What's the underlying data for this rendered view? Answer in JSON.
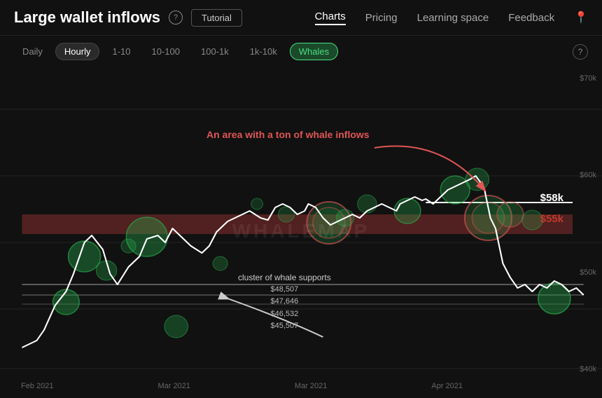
{
  "header": {
    "title": "Large wallet inflows",
    "help_label": "?",
    "tutorial_label": "Tutorial",
    "nav": [
      {
        "label": "Charts",
        "active": true
      },
      {
        "label": "Pricing",
        "active": false
      },
      {
        "label": "Learning space",
        "active": false
      },
      {
        "label": "Feedback",
        "active": false
      }
    ],
    "location_icon": "📍"
  },
  "filter_bar": {
    "filters": [
      {
        "label": "Daily",
        "active": false,
        "highlight": false
      },
      {
        "label": "Hourly",
        "active": true,
        "highlight": false
      },
      {
        "label": "1-10",
        "active": false,
        "highlight": false
      },
      {
        "label": "10-100",
        "active": false,
        "highlight": false
      },
      {
        "label": "100-1k",
        "active": false,
        "highlight": false
      },
      {
        "label": "1k-10k",
        "active": false,
        "highlight": false
      },
      {
        "label": "Whales",
        "active": false,
        "highlight": true
      }
    ],
    "info_icon": "?"
  },
  "chart": {
    "y_labels": [
      "$70k",
      "$60k",
      "$50k",
      "$40k"
    ],
    "x_labels": [
      "Feb 2021",
      "Mar 2021",
      "Mar 2021",
      "Apr 2021",
      ""
    ],
    "watermark": "WHALEMAP",
    "annotations": {
      "whale_inflow_text": "An area with a ton of whale inflows",
      "price_58k": "$58k",
      "price_55k": "$55k",
      "cluster_title": "cluster of whale supports",
      "cluster_prices": [
        "$48,507",
        "$47,646",
        "$46,532",
        "$45,507"
      ]
    }
  }
}
